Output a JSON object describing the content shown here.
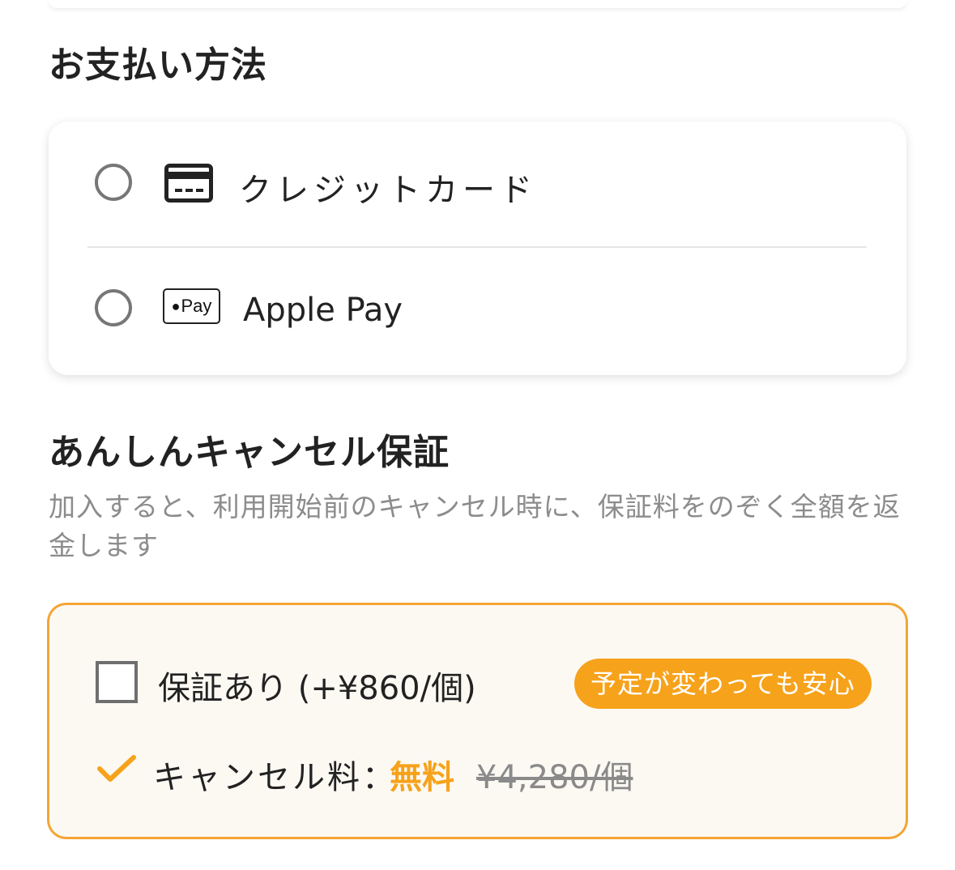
{
  "payment": {
    "title": "お支払い方法",
    "options": [
      {
        "label": "クレジットカード",
        "icon": "credit-card-icon",
        "selected": false
      },
      {
        "label": "Apple Pay",
        "icon": "apple-pay-icon",
        "icon_text": "Pay",
        "selected": false
      }
    ]
  },
  "guarantee": {
    "title": "あんしんキャンセル保証",
    "description": "加入すると、利用開始前のキャンセル時に、保証料をのぞく全額を返金します",
    "checkbox_label": "保証あり (+¥860/個)",
    "checked": false,
    "badge": "予定が変わっても安心",
    "fee_label": "キャンセル料：",
    "fee_value": "無料",
    "fee_original": "¥4,280/個",
    "accent_color": "#f7a21b",
    "border_color": "#f4a534"
  }
}
